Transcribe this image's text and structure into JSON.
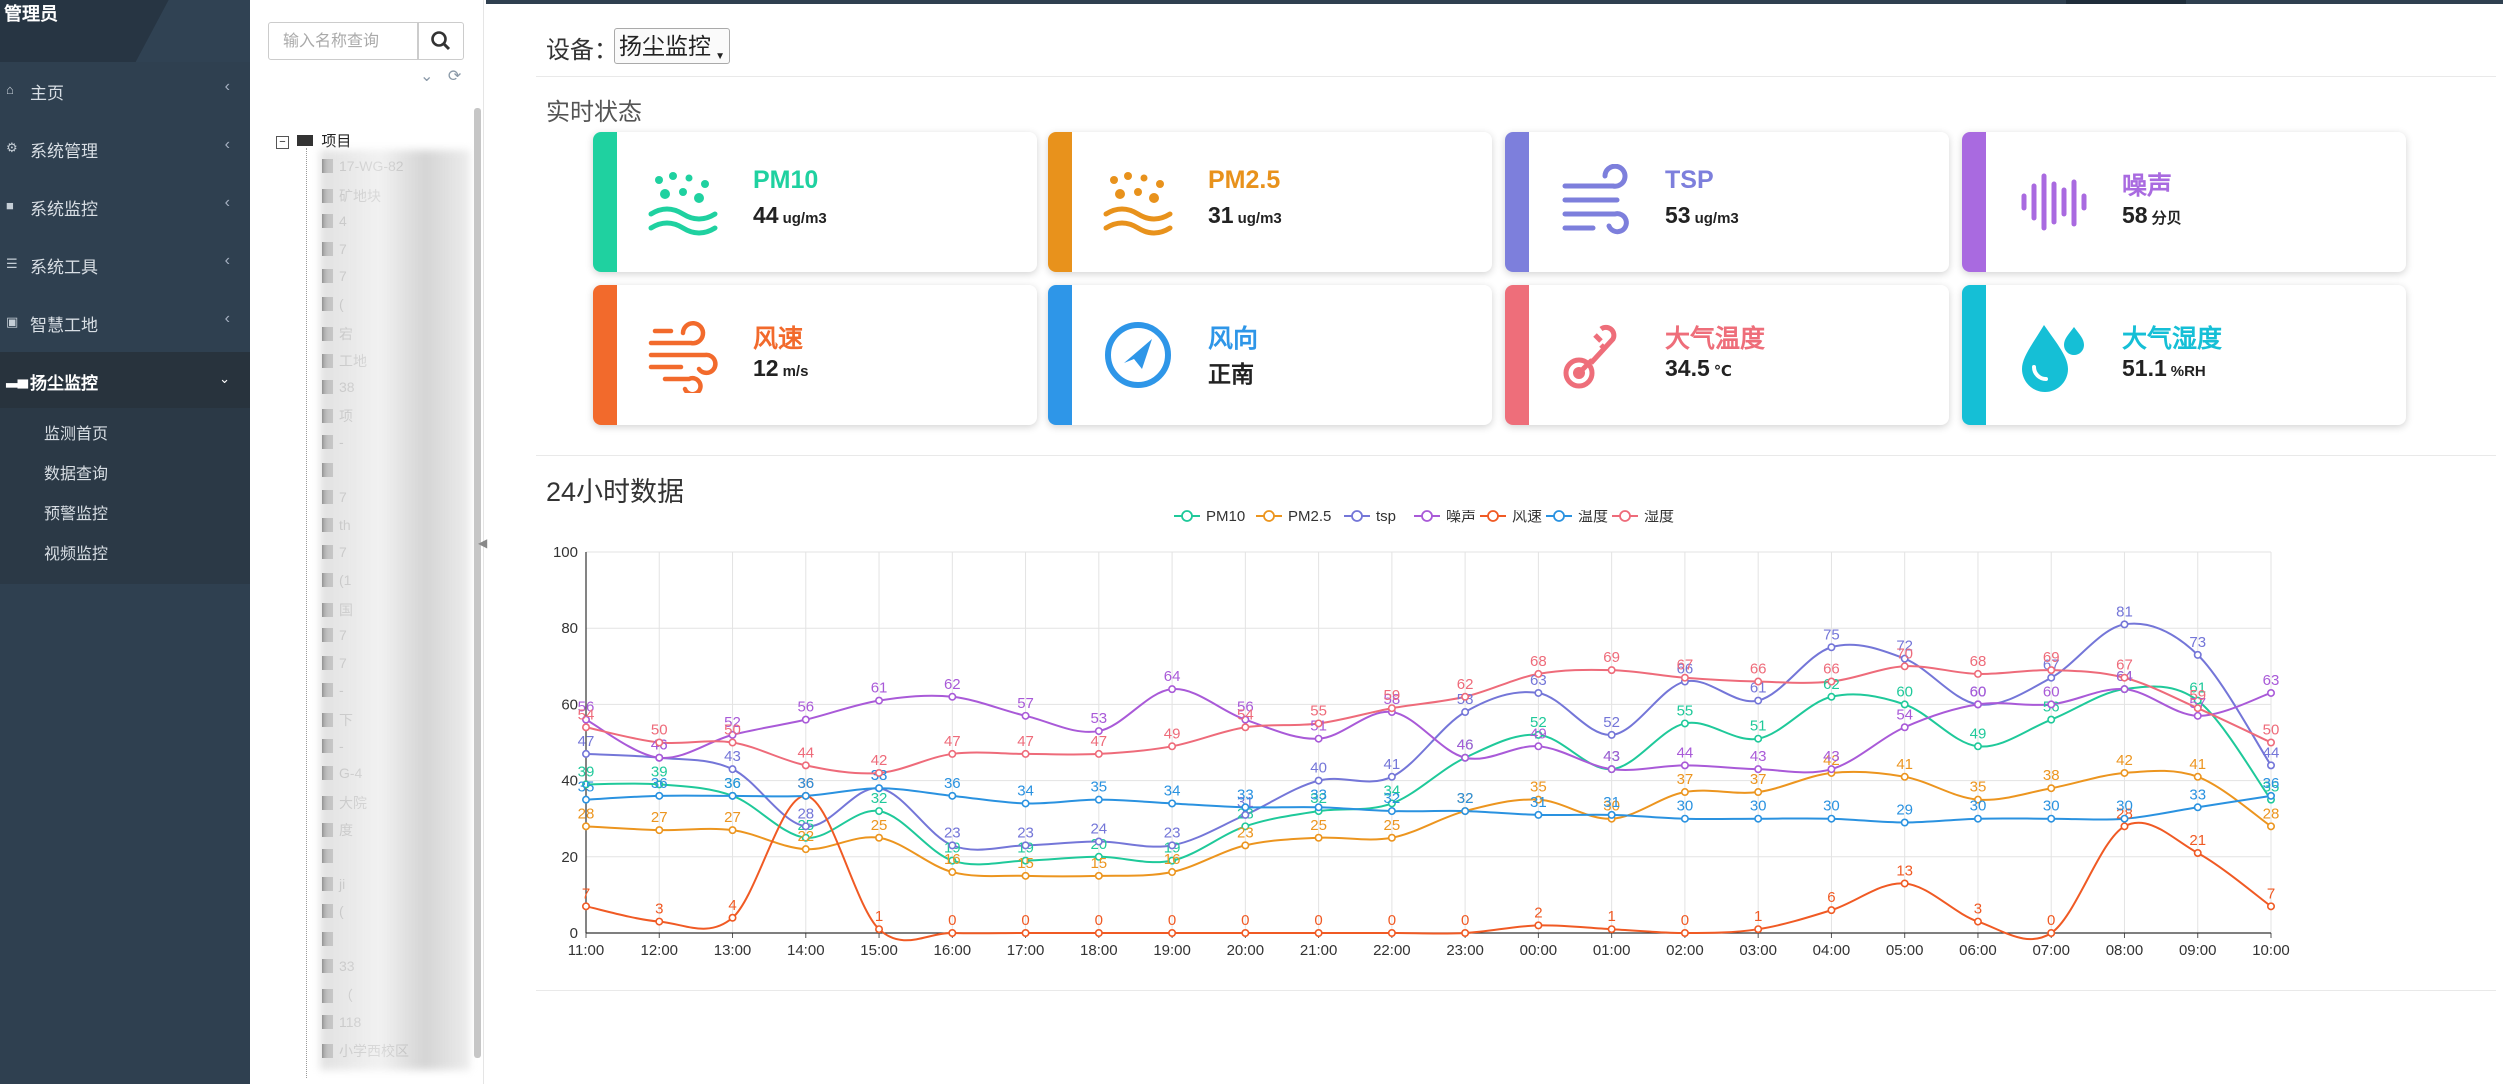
{
  "user": {
    "name": "管理员"
  },
  "menu": [
    {
      "label": "主页",
      "icon": "home-icon"
    },
    {
      "label": "系统管理",
      "icon": "gear-icon"
    },
    {
      "label": "系统监控",
      "icon": "video-icon"
    },
    {
      "label": "系统工具",
      "icon": "list-icon"
    },
    {
      "label": "智慧工地",
      "icon": "book-icon"
    },
    {
      "label": "扬尘监控",
      "icon": "bar-chart-icon"
    }
  ],
  "submenu": [
    "监测首页",
    "数据查询",
    "预警监控",
    "视频监控"
  ],
  "tree": {
    "search_placeholder": "输入名称查询",
    "root_label": "项目",
    "nodes": [
      "17-WG-82",
      "矿地块",
      "4",
      "7",
      "7",
      "(",
      "宕",
      "工地",
      "38",
      "项",
      "-",
      "",
      "7",
      "th",
      "7",
      "(1",
      "国",
      "7",
      "7",
      "-",
      "下",
      "-",
      "G-4",
      "大院",
      "度",
      "",
      "ji",
      "(",
      "",
      "33",
      "（",
      "118",
      "小学西校区"
    ]
  },
  "device": {
    "label": "设备：",
    "selected": "扬尘监控"
  },
  "realtime": {
    "title": "实时状态",
    "cards": [
      {
        "name": "PM10",
        "value": "44",
        "unit": "ug/m3",
        "color": "#1fd1a0",
        "icon": "particles-icon"
      },
      {
        "name": "PM2.5",
        "value": "31",
        "unit": "ug/m3",
        "color": "#e8921c",
        "icon": "particles-icon"
      },
      {
        "name": "TSP",
        "value": "53",
        "unit": "ug/m3",
        "color": "#7d7fdc",
        "icon": "wind-lines-icon"
      },
      {
        "name": "噪声",
        "value": "58",
        "unit": "分贝",
        "color": "#a96ae0",
        "icon": "soundwave-icon"
      },
      {
        "name": "风速",
        "value": "12",
        "unit": "m/s",
        "color": "#f26a2c",
        "icon": "wind-icon"
      },
      {
        "name": "风向",
        "value": "正南",
        "unit": "",
        "color": "#2e96e8",
        "icon": "compass-icon"
      },
      {
        "name": "大气温度",
        "value": "34.5",
        "unit": "℃",
        "color": "#ee6e7a",
        "icon": "thermometer-icon"
      },
      {
        "name": "大气湿度",
        "value": "51.1",
        "unit": "%RH",
        "color": "#15bfd6",
        "icon": "droplet-icon"
      }
    ]
  },
  "chart": {
    "title": "24小时数据"
  },
  "chart_data": {
    "type": "line",
    "x": [
      "11:00",
      "12:00",
      "13:00",
      "14:00",
      "15:00",
      "16:00",
      "17:00",
      "18:00",
      "19:00",
      "20:00",
      "21:00",
      "22:00",
      "23:00",
      "00:00",
      "01:00",
      "02:00",
      "03:00",
      "04:00",
      "05:00",
      "06:00",
      "07:00",
      "08:00",
      "09:00",
      "10:00"
    ],
    "ylim": [
      0,
      100
    ],
    "yticks": [
      0,
      20,
      40,
      60,
      80,
      100
    ],
    "legend_position": "top-center",
    "grid": true,
    "smooth": true,
    "series": [
      {
        "name": "PM10",
        "color": "#1fc99a",
        "values": [
          39,
          39,
          36,
          25,
          32,
          19,
          19,
          20,
          19,
          28,
          32,
          34,
          46,
          52,
          43,
          55,
          51,
          62,
          60,
          49,
          56,
          64,
          61,
          35
        ]
      },
      {
        "name": "PM2.5",
        "color": "#ec951f",
        "values": [
          28,
          27,
          27,
          22,
          25,
          16,
          15,
          15,
          16,
          23,
          25,
          25,
          32,
          35,
          30,
          37,
          37,
          42,
          41,
          35,
          38,
          42,
          41,
          28
        ]
      },
      {
        "name": "tsp",
        "color": "#7476d8",
        "values": [
          47,
          46,
          43,
          28,
          38,
          23,
          23,
          24,
          23,
          31,
          40,
          41,
          58,
          63,
          52,
          66,
          61,
          75,
          72,
          60,
          67,
          81,
          73,
          44
        ]
      },
      {
        "name": "噪声",
        "color": "#a95ad8",
        "values": [
          56,
          46,
          52,
          56,
          61,
          62,
          57,
          53,
          64,
          56,
          51,
          58,
          46,
          49,
          43,
          44,
          43,
          43,
          54,
          60,
          60,
          64,
          57,
          63
        ]
      },
      {
        "name": "风速",
        "color": "#f05a24",
        "values": [
          7,
          3,
          4,
          36,
          1,
          0,
          0,
          0,
          0,
          0,
          0,
          0,
          0,
          2,
          1,
          0,
          1,
          6,
          13,
          3,
          0,
          28,
          21,
          7
        ]
      },
      {
        "name": "温度",
        "color": "#2a92e0",
        "values": [
          35,
          36,
          36,
          36,
          38,
          36,
          34,
          35,
          34,
          33,
          33,
          32,
          32,
          31,
          31,
          30,
          30,
          30,
          29,
          30,
          30,
          30,
          33,
          36
        ]
      },
      {
        "name": "湿度",
        "color": "#ee6b7a",
        "values": [
          54,
          50,
          50,
          44,
          42,
          47,
          47,
          47,
          49,
          54,
          55,
          59,
          62,
          68,
          69,
          67,
          66,
          66,
          70,
          68,
          69,
          67,
          59,
          50
        ]
      }
    ]
  }
}
